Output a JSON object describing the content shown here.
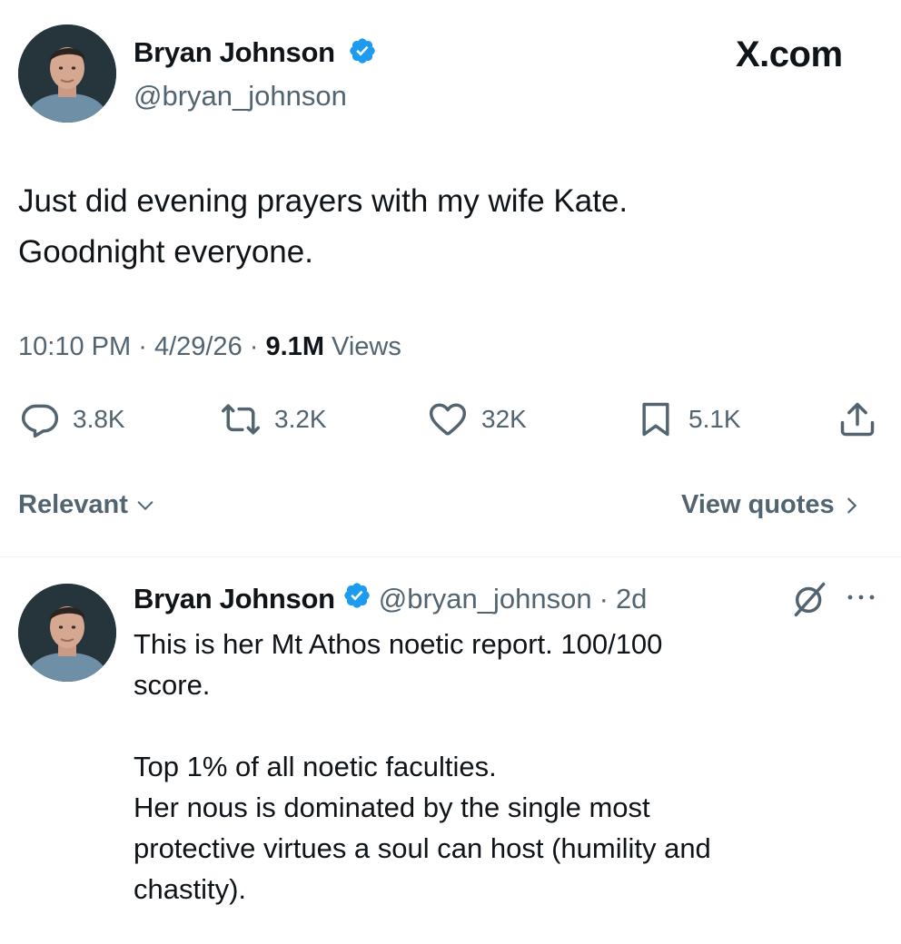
{
  "tweet": {
    "author": {
      "name": "Bryan Johnson",
      "handle": "@bryan_johnson",
      "verified": true,
      "avatar_icon": "profile-photo"
    },
    "site_label": "X.com",
    "text_line1": "Just did evening prayers with my wife Kate.",
    "text_line2": "Goodnight everyone.",
    "time": "10:10 PM",
    "date": "4/29/26",
    "separator": "·",
    "views_count": "9.1M",
    "views_label": "Views",
    "stats": {
      "replies": "3.8K",
      "reposts": "3.2K",
      "likes": "32K",
      "bookmarks": "5.1K"
    }
  },
  "sort": {
    "label": "Relevant",
    "view_quotes": "View quotes"
  },
  "reply": {
    "author": {
      "name": "Bryan Johnson",
      "handle": "@bryan_johnson",
      "age": "2d",
      "separator": "·",
      "verified": true
    },
    "lines": [
      "This is her Mt Athos noetic report. 100/100",
      "score.",
      "",
      "Top 1% of all noetic faculties.",
      "Her nous is dominated by the single most",
      "protective virtues a soul can host (humility and",
      "chastity)."
    ]
  },
  "colors": {
    "text": "#0f1419",
    "secondary": "#536471",
    "verified_blue": "#1d9bf0",
    "divider": "#eff3f4"
  },
  "icons": [
    "verified-badge-icon",
    "reply-icon",
    "repost-icon",
    "like-icon",
    "bookmark-icon",
    "share-icon",
    "chevron-down-icon",
    "chevron-right-icon",
    "grok-icon",
    "more-icon"
  ]
}
